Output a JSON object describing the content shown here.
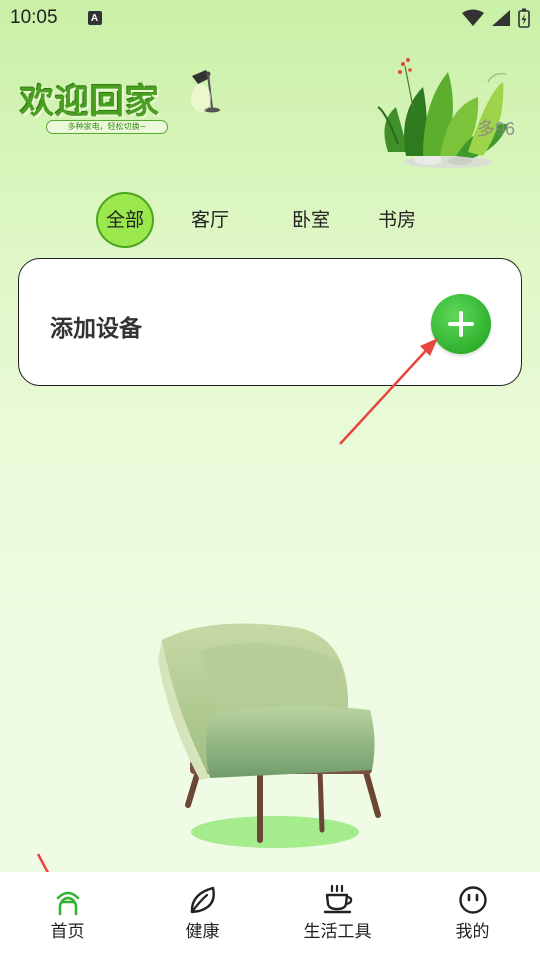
{
  "status_bar": {
    "time": "10:05",
    "app_icon_letter": "A"
  },
  "header": {
    "title": "欢迎回家",
    "subtitle": "多种家电，轻松切换~",
    "weather_text": "多96"
  },
  "room_tabs": [
    {
      "label": "全部",
      "active": true
    },
    {
      "label": "客厅",
      "active": false
    },
    {
      "label": "卧室",
      "active": false
    },
    {
      "label": "书房",
      "active": false
    }
  ],
  "add_device": {
    "label": "添加设备",
    "button_icon": "plus-icon"
  },
  "bottom_nav": [
    {
      "label": "首页",
      "icon": "home-icon",
      "active": true
    },
    {
      "label": "健康",
      "icon": "leaf-icon",
      "active": false
    },
    {
      "label": "生活工具",
      "icon": "coffee-cup-icon",
      "active": false
    },
    {
      "label": "我的",
      "icon": "smiley-face-icon",
      "active": false
    }
  ],
  "colors": {
    "accent_green": "#4aa51e",
    "active_tab_fill": "#9be84e",
    "add_button": "#2fb12d",
    "annotation_arrow": "#e8453c"
  }
}
